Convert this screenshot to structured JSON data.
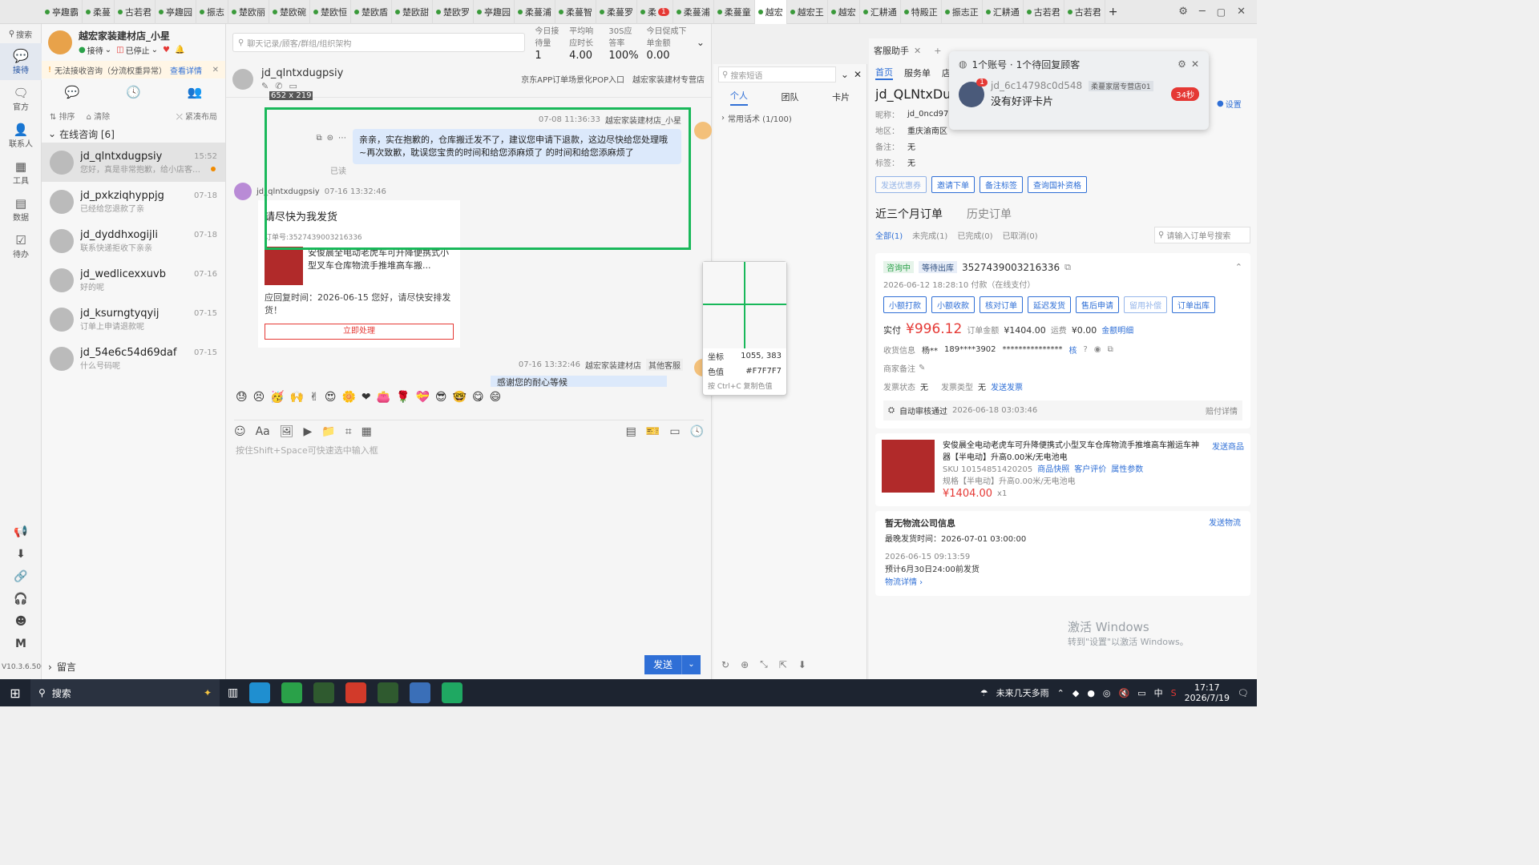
{
  "tabs": [
    {
      "label": "亭趣霸"
    },
    {
      "label": "柔蔓"
    },
    {
      "label": "古若君"
    },
    {
      "label": "亭趣园"
    },
    {
      "label": "振志"
    },
    {
      "label": "楚欧丽"
    },
    {
      "label": "楚欧碗"
    },
    {
      "label": "楚欧恒"
    },
    {
      "label": "楚欧盾"
    },
    {
      "label": "楚欧甜"
    },
    {
      "label": "楚欧罗"
    },
    {
      "label": "亭趣园"
    },
    {
      "label": "柔蔓浦"
    },
    {
      "label": "柔蔓智"
    },
    {
      "label": "柔蔓罗"
    },
    {
      "label": "柔",
      "badge": "1"
    },
    {
      "label": "柔蔓浦"
    },
    {
      "label": "柔蔓童"
    },
    {
      "label": "越宏"
    },
    {
      "label": "越宏王"
    },
    {
      "label": "越宏"
    },
    {
      "label": "汇耕通"
    },
    {
      "label": "特殿正"
    },
    {
      "label": "振志正"
    },
    {
      "label": "汇耕通"
    },
    {
      "label": "古若君"
    },
    {
      "label": "古若君"
    }
  ],
  "rail": {
    "search": "搜索",
    "items": [
      "接待",
      "官方",
      "联系人",
      "工具",
      "数据",
      "待办"
    ],
    "version": "V10.3.6.500"
  },
  "store": {
    "name": "越宏家装建材店_小星",
    "status_reception": "接待",
    "status_stopped": "已停止",
    "warning": "无法接收咨询（分流权重异常）",
    "warning_link": "查看详情",
    "toolbar_sort": "排序",
    "toolbar_clear": "清除",
    "toolbar_layout": "紧凑布局",
    "group": "在线咨询 [6]",
    "footer": "留言"
  },
  "contacts": [
    {
      "name": "jd_qlntxdugpsiy",
      "preview": "您好，真是非常抱歉，给小店客服...",
      "time": "15:52",
      "unread": true
    },
    {
      "name": "jd_pxkziqhyppjg",
      "preview": "已经给您退款了亲",
      "time": "07-18"
    },
    {
      "name": "jd_dyddhxogijli",
      "preview": "联系快递拒收下亲亲",
      "time": "07-18"
    },
    {
      "name": "jd_wedlicexxuvb",
      "preview": "好的呢",
      "time": "07-16"
    },
    {
      "name": "jd_ksurngtyqyij",
      "preview": "订单上申请退款呢",
      "time": "07-15"
    },
    {
      "name": "jd_54e6c54d69daf",
      "preview": "什么号码呢",
      "time": "07-15"
    }
  ],
  "search": {
    "placeholder": "聊天记录/顾客/群组/组织架构"
  },
  "stats": [
    {
      "label": "今日接待量",
      "value": "1"
    },
    {
      "label": "平均响应时长",
      "value": "4.00"
    },
    {
      "label": "30S应答率",
      "value": "100%"
    },
    {
      "label": "今日促成下单金额",
      "value": "0.00"
    }
  ],
  "chat": {
    "customer": "jd_qlntxdugpsiy",
    "source": "京东APP订单场景化POP入口",
    "shop": "越宏家装建材专营店",
    "msg1": {
      "time": "07-08 11:36:33",
      "sender": "越宏家装建材店_小星",
      "text": "亲亲，实在抱歉的，仓库搬迁发不了，建议您申请下退款，这边尽快给您处理哦~再次致歉，耽误您宝贵的时间和给您添麻烦了 的时间和给您添麻烦了",
      "read": "已读"
    },
    "msg2": {
      "sender": "jd_qlntxdugpsiy",
      "time": "07-16 13:32:46",
      "title": "请尽快为我发货",
      "order": "订单号:3527439003216336",
      "product": "安俊晨全电动老虎车可升降便携式小型叉车仓库物流手推堆高车搬...",
      "reply_deadline": "应回复时间：2026-06-15 您好，请尽快安排发货！",
      "action": "立即处理"
    },
    "msg3": {
      "time": "07-16 13:32:46",
      "sender": "越宏家装建材店",
      "tag": "其他客服",
      "text": "感谢您的耐心等候"
    },
    "input_placeholder": "按住Shift+Space可快速选中输入框",
    "send": "发送",
    "selection_size": "652 x 219"
  },
  "quick_reply": {
    "placeholder": "搜索短语",
    "tabs": [
      "个人",
      "团队",
      "卡片"
    ],
    "group": "常用话术 (1/100)"
  },
  "color_picker": {
    "coord_label": "坐标",
    "coord_value": "1055, 383",
    "color_label": "色值",
    "color_value": "#F7F7F7",
    "hint": "按 Ctrl+C 复制色值"
  },
  "assistant": {
    "title": "客服助手",
    "nav": [
      "首页",
      "服务单",
      "店"
    ],
    "customer": "jd_QLNtxDug",
    "nickname_label": "昵称：",
    "nickname": "jd_0ncd97",
    "region_label": "地区：",
    "region": "重庆渝南区",
    "remark_label": "备注：",
    "remark": "无",
    "tag_label": "标签：",
    "tag": "无",
    "buttons": [
      "发送优惠券",
      "邀请下单",
      "备注标签",
      "查询国补资格"
    ],
    "orders_title": "近三个月订单",
    "history_title": "历史订单",
    "order_filters": [
      "全部(1)",
      "未完成(1)",
      "已完成(0)",
      "已取消(0)"
    ],
    "order_search": "请输入订单号搜索",
    "order": {
      "status": "咨询中",
      "status2": "等待出库",
      "id": "3527439003216336",
      "paid_time": "2026-06-12 18:28:10 付款（在线支付）",
      "actions": [
        "小额打款",
        "小额收款",
        "核对订单",
        "延迟发货",
        "售后申请",
        "留用补偿",
        "订单出库"
      ],
      "paid_label": "实付",
      "paid": "¥996.12",
      "amount_label": "订单金额",
      "amount": "¥1404.00",
      "shipping_label": "运费",
      "shipping": "¥0.00",
      "detail_link": "金额明细",
      "receiver_label": "收货信息",
      "receiver": "杨**",
      "phone": "189****3902",
      "address": "***************",
      "merchant_remark": "商家备注",
      "invoice_status_label": "发票状态",
      "invoice_status": "无",
      "invoice_type_label": "发票类型",
      "invoice_type": "无",
      "invoice_link": "发送发票",
      "audit": "自动审核通过",
      "audit_time": "2026-06-18 03:03:46",
      "compensation": "赔付详情",
      "product_name": "安俊晨全电动老虎车可升降便携式小型叉车仓库物流手推堆高车搬运车神器【半电动】升高0.00米/无电池电",
      "sku": "SKU 10154851420205",
      "sku_links": [
        "商品快照",
        "客户评价",
        "属性参数"
      ],
      "spec": "规格【半电动】升高0.00米/无电池电",
      "product_price": "¥1404.00",
      "qty": "x1",
      "send_product": "发送商品",
      "logistics_title": "暂无物流公司信息",
      "logistics_link": "发送物流",
      "latest_ship_label": "最晚发货时间：",
      "latest_ship": "2026-07-01 03:00:00",
      "ship_time": "2026-06-15 09:13:59",
      "ship_note": "预计6月30日24:00前发货",
      "logistics_detail": "物流详情"
    }
  },
  "notification": {
    "title": "1个账号 · 1个待回复顾客",
    "user": "jd_6c14798c0d548",
    "shop": "柔蔓家居专营店01",
    "message": "没有好评卡片",
    "timer": "34秒",
    "settings": "设置"
  },
  "windows_watermark": {
    "line1": "激活 Windows",
    "line2": "转到\"设置\"以激活 Windows。"
  },
  "taskbar": {
    "search": "搜索",
    "weather": "未来几天多雨",
    "ime": "中",
    "time": "17:17",
    "date": "2026/7/19"
  },
  "colors": {
    "accent": "#2f6fd6",
    "selection": "#19b85a",
    "price": "#e53935"
  }
}
